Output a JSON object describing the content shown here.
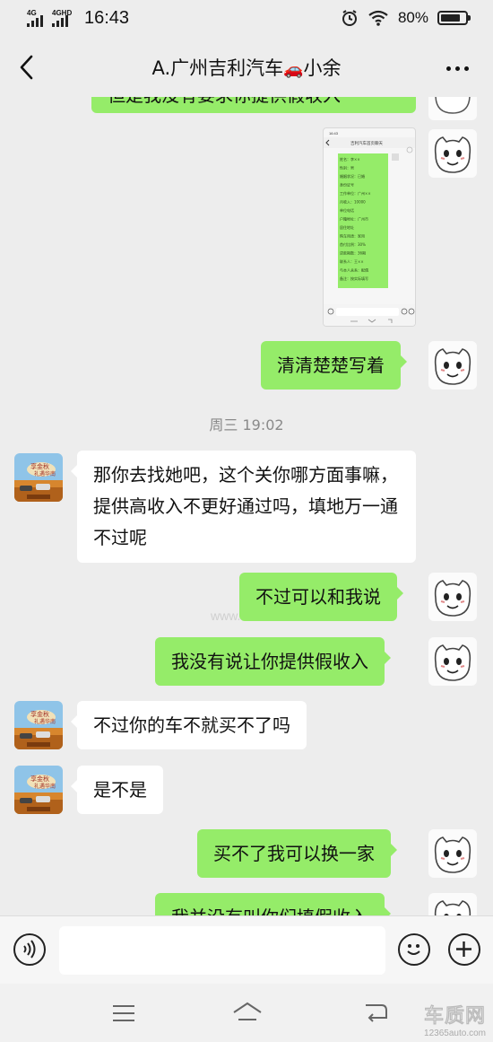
{
  "status": {
    "network1": "4G",
    "network2": "4GHD",
    "time": "16:43",
    "battery": "80%",
    "battery_level": 0.8
  },
  "header": {
    "title_prefix": "A.广州吉利汽车",
    "title_suffix": "小余",
    "car_glyph": "🚗"
  },
  "messages": {
    "top_partial": "但是我没有要求你提供假收入",
    "m1": "清清楚楚写着",
    "timestamp": "周三 19:02",
    "m2": "那你去找她吧，这个关你哪方面事嘛，提供高收入不更好通过吗，填地万一通不过呢",
    "m3": "不过可以和我说",
    "m4": "我没有说让你提供假收入",
    "m5": "不过你的车不就买不了吗",
    "m6": "是不是",
    "m7": "买不了我可以换一家",
    "m8_partial": "我并没有叫你们填假收入"
  },
  "screenshot_thumb": {
    "header": "吉利汽车首页聊天",
    "lines": [
      "姓名：李××",
      "性别：男",
      "婚姻状况：已婚",
      "身份证号",
      "工作单位：广州××",
      "月收入：10000",
      "单位电话",
      "户籍地址：广州市",
      "居住地址",
      "购车用途：家用",
      "首付比例：30%",
      "贷款期数：36期",
      "联系人：王××",
      "与本人关系：配偶",
      "备注：按实际填写"
    ]
  },
  "watermark": "www.12365auto.com",
  "brand": {
    "name": "车质网",
    "url": "12365auto.com"
  },
  "colors": {
    "my_bubble": "#95ec69",
    "other_bubble": "#ffffff",
    "background": "#ededed"
  }
}
